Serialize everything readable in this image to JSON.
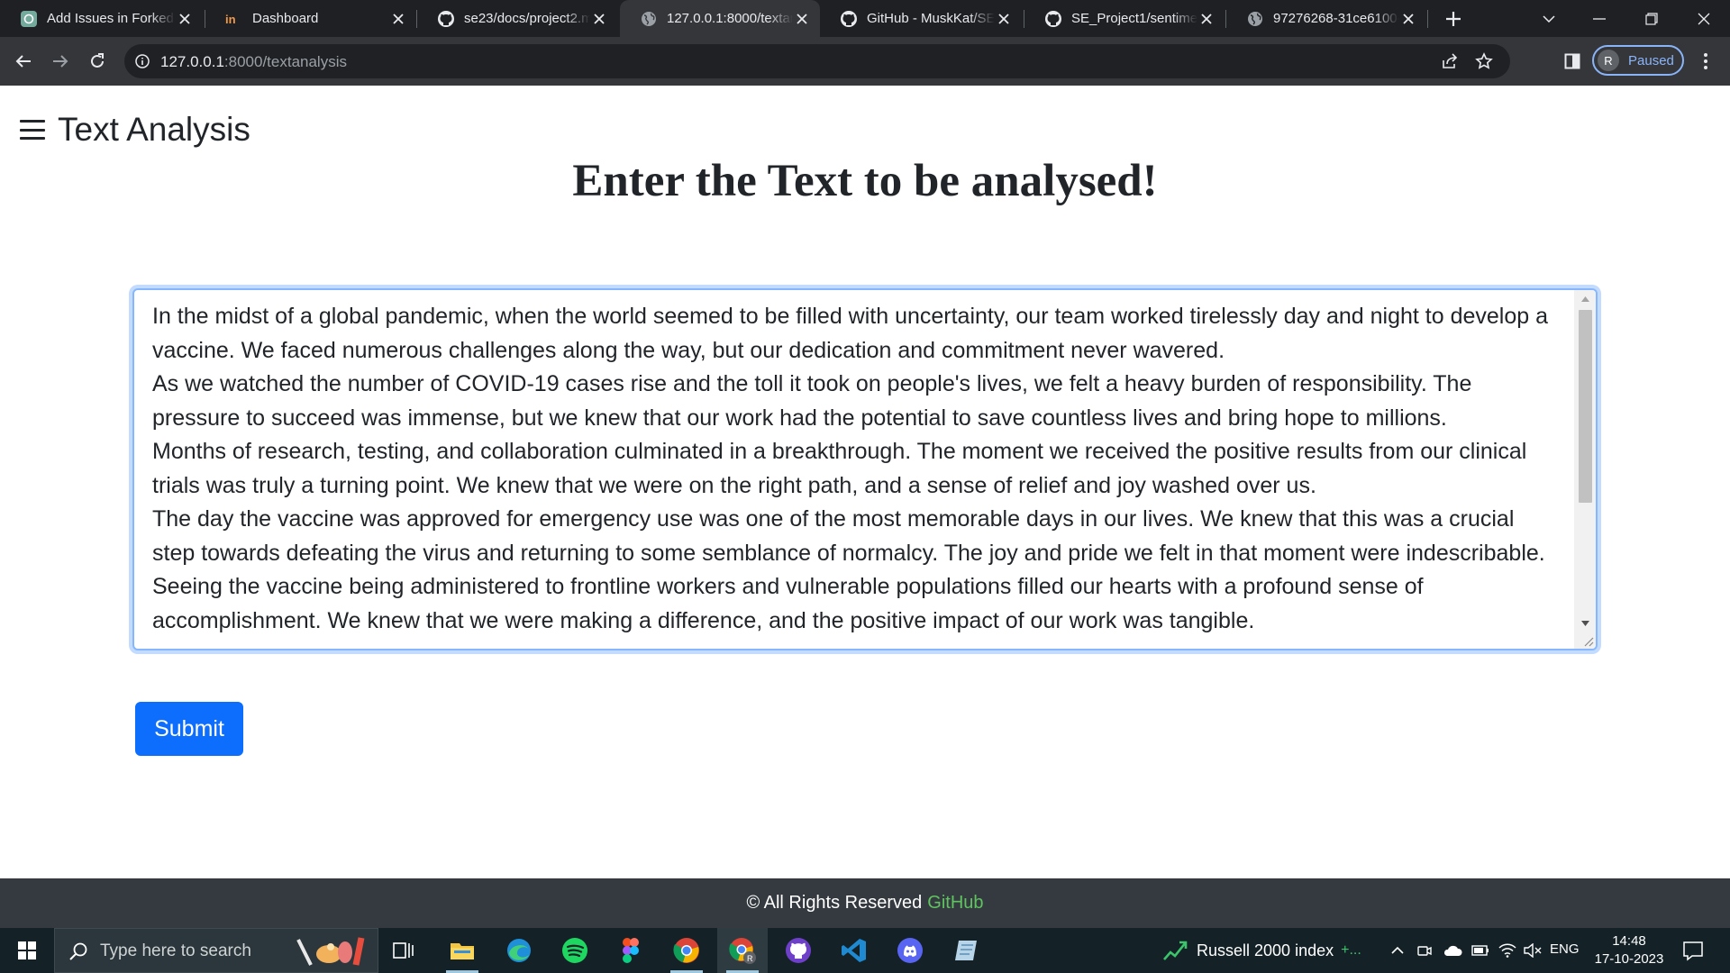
{
  "browser": {
    "tabs": [
      {
        "title": "Add Issues in Forked",
        "icon": "chatgpt-icon",
        "active": false
      },
      {
        "title": "Dashboard",
        "icon": "brand-logo-icon",
        "active": false
      },
      {
        "title": "se23/docs/project2.m",
        "icon": "github-icon",
        "active": false
      },
      {
        "title": "127.0.0.1:8000/textan",
        "icon": "globe-icon",
        "active": true
      },
      {
        "title": "GitHub - MuskKat/SE",
        "icon": "github-icon",
        "active": false
      },
      {
        "title": "SE_Project1/sentimen",
        "icon": "github-icon",
        "active": false
      },
      {
        "title": "97276268-31ce6100-",
        "icon": "globe-icon",
        "active": false
      }
    ],
    "address": {
      "host": "127.0.0.1",
      "rest": ":8000/textanalysis"
    },
    "profile": {
      "initial": "R",
      "label": "Paused"
    }
  },
  "page": {
    "brand": "Text Analysis",
    "heading": "Enter the Text to be analysed!",
    "textarea_value": "In the midst of a global pandemic, when the world seemed to be filled with uncertainty, our team worked tirelessly day and night to develop a vaccine. We faced numerous challenges along the way, but our dedication and commitment never wavered.\nAs we watched the number of COVID-19 cases rise and the toll it took on people's lives, we felt a heavy burden of responsibility. The pressure to succeed was immense, but we knew that our work had the potential to save countless lives and bring hope to millions.\nMonths of research, testing, and collaboration culminated in a breakthrough. The moment we received the positive results from our clinical trials was truly a turning point. We knew that we were on the right path, and a sense of relief and joy washed over us.\nThe day the vaccine was approved for emergency use was one of the most memorable days in our lives. We knew that this was a crucial step towards defeating the virus and returning to some semblance of normalcy. The joy and pride we felt in that moment were indescribable.\nSeeing the vaccine being administered to frontline workers and vulnerable populations filled our hearts with a profound sense of accomplishment. We knew that we were making a difference, and the positive impact of our work was tangible.",
    "submit_label": "Submit",
    "footer": {
      "text": "© All Rights Reserved",
      "link": "GitHub"
    }
  },
  "taskbar": {
    "search_placeholder": "Type here to search",
    "stock": {
      "name": "Russell 2000 index",
      "change": "+..."
    },
    "lang": "ENG",
    "time": "14:48",
    "date": "17-10-2023"
  },
  "colors": {
    "primary": "#0d6efd",
    "footer_bg": "#343a40",
    "footer_link": "#5fc45f",
    "chrome_bg": "#35363a"
  }
}
